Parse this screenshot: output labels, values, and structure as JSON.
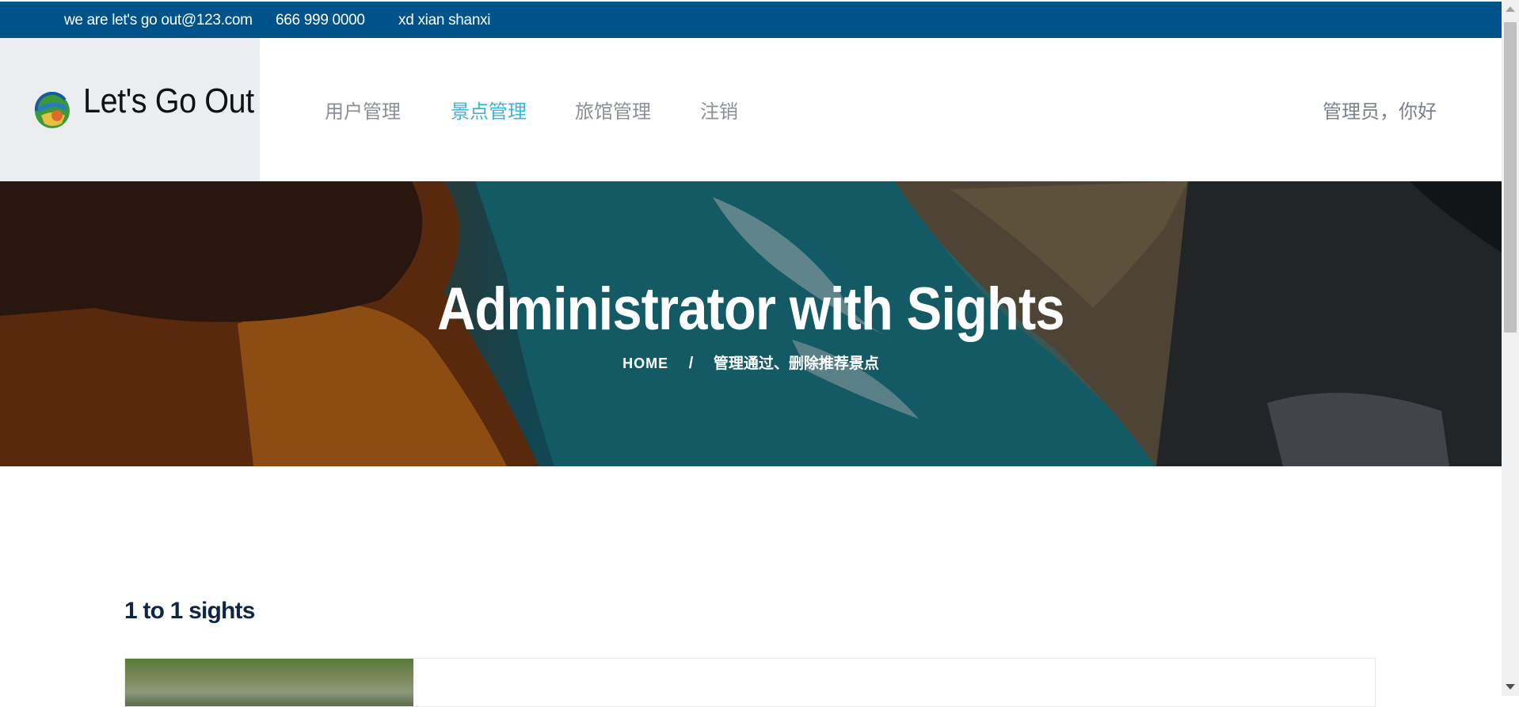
{
  "topbar": {
    "email": "we are let's go out@123.com",
    "phone": "666 999 0000",
    "address": "xd xian shanxi"
  },
  "brand": {
    "name": "Let's Go Out",
    "logo_icon": "globe-logo-icon"
  },
  "nav": {
    "items": [
      {
        "label": "用户管理"
      },
      {
        "label": "景点管理"
      },
      {
        "label": "旅馆管理"
      },
      {
        "label": "注销"
      }
    ],
    "active_index": 1,
    "greeting": "管理员，你好",
    "active_color": "#3ab3e0"
  },
  "hero": {
    "title": "Administrator with Sights",
    "breadcrumb_home": "HOME",
    "breadcrumb_sep": "/",
    "breadcrumb_current": "管理通过、删除推荐景点"
  },
  "content": {
    "count_text": "1 to 1 sights"
  },
  "colors": {
    "topbar_bg": "#00528a",
    "brand_box_bg": "#ebeef1",
    "count_text": "#0f2744"
  }
}
